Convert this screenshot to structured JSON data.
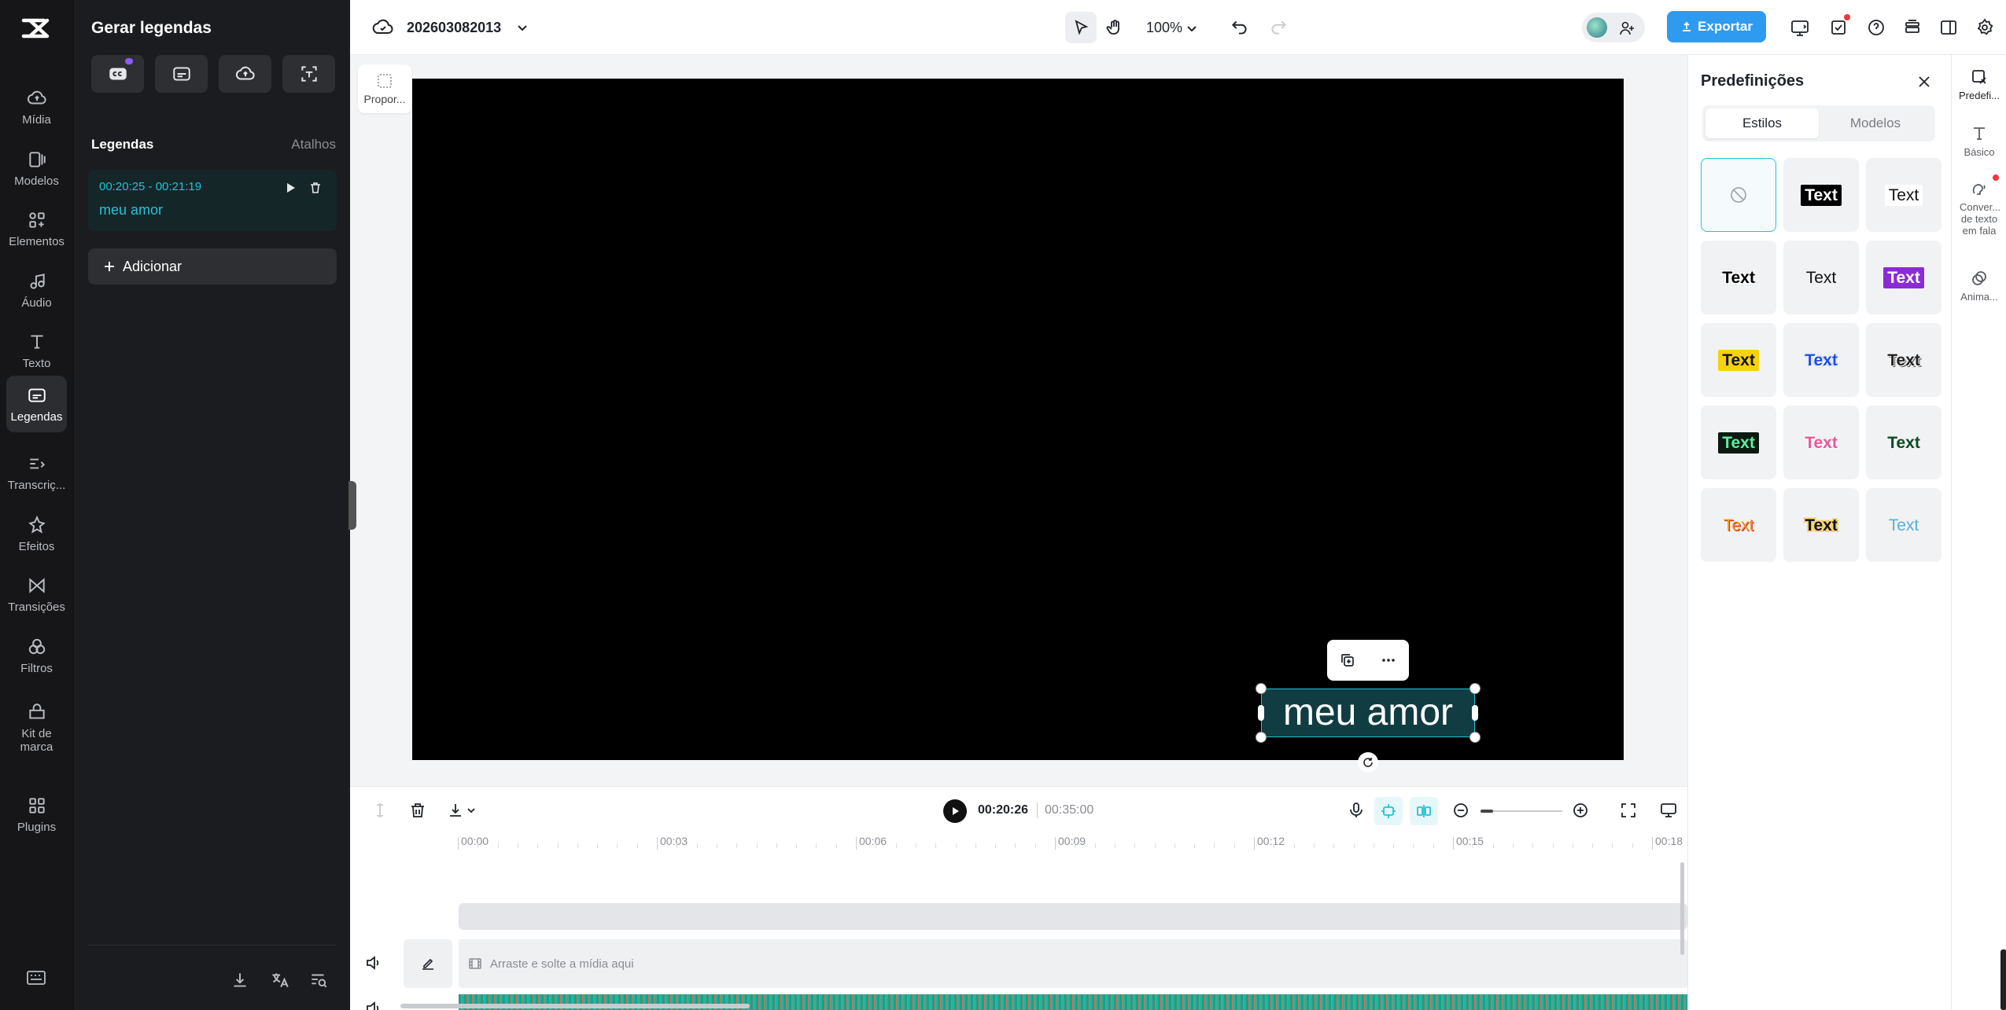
{
  "rail": {
    "items": [
      {
        "label": "Mídia",
        "icon": "cloud-upload-icon"
      },
      {
        "label": "Modelos",
        "icon": "templates-icon"
      },
      {
        "label": "Elementos",
        "icon": "elements-icon"
      },
      {
        "label": "Áudio",
        "icon": "music-note-icon"
      },
      {
        "label": "Texto",
        "icon": "text-icon"
      },
      {
        "label": "Legendas",
        "icon": "captions-icon"
      },
      {
        "label": "Transcriç...",
        "icon": "transcript-icon"
      },
      {
        "label": "Efeitos",
        "icon": "effects-icon"
      },
      {
        "label": "Transições",
        "icon": "transitions-icon"
      },
      {
        "label": "Filtros",
        "icon": "filters-icon"
      },
      {
        "label": "Kit de marca",
        "icon": "brand-kit-icon"
      },
      {
        "label": "Plugins",
        "icon": "plugins-icon"
      }
    ],
    "active": "Legendas"
  },
  "panel": {
    "title": "Gerar legendas",
    "section_title": "Legendas",
    "shortcuts_link": "Atalhos",
    "subtitle": {
      "time": "00:20:25 - 00:21:19",
      "text": "meu amor"
    },
    "add_label": "Adicionar"
  },
  "topbar": {
    "project_name": "202603082013",
    "zoom": "100%",
    "export_label": "Exportar"
  },
  "canvas": {
    "ratio_label": "Propor...",
    "caption_text": "meu amor"
  },
  "presets": {
    "title": "Predefinições",
    "tabs": [
      "Estilos",
      "Modelos"
    ],
    "active_tab": "Estilos",
    "tile_text": "Text"
  },
  "right_rail": {
    "items": [
      "Predefi...",
      "Básico",
      "Conver... de texto em fala",
      "Anima..."
    ]
  },
  "timeline": {
    "current_time": "00:20:26",
    "total_time": "00:35:00",
    "ruler": [
      "00:00",
      "00:03",
      "00:06",
      "00:09",
      "00:12",
      "00:15",
      "00:18"
    ],
    "drop_hint": "Arraste e solte a mídia aqui",
    "zoom_level": 0.15
  },
  "colors": {
    "accent": "#22c3d6",
    "export": "#2f9bf0",
    "rail_bg": "#161618"
  }
}
